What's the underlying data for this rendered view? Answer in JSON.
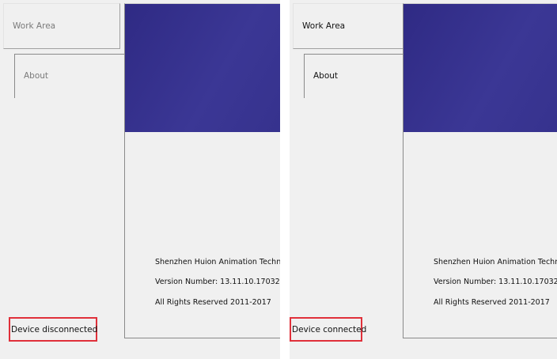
{
  "panels": [
    {
      "tabs": {
        "work_area": "Work Area",
        "about": "About"
      },
      "about": {
        "company": "Shenzhen Huion Animation Technology",
        "version": "Version Number: 13.11.10.17032",
        "rights": "All Rights Reserved 2011-2017"
      },
      "status": "Device disconnected"
    },
    {
      "tabs": {
        "work_area": "Work Area",
        "about": "About"
      },
      "about": {
        "company": "Shenzhen Huion Animation Technology",
        "version": "Version Number: 13.11.10.17032",
        "rights": "All Rights Reserved 2011-2017"
      },
      "status": "Device connected"
    }
  ],
  "colors": {
    "banner": "#332e8c",
    "highlight": "#e0303a",
    "window_bg": "#f0f0f0"
  }
}
